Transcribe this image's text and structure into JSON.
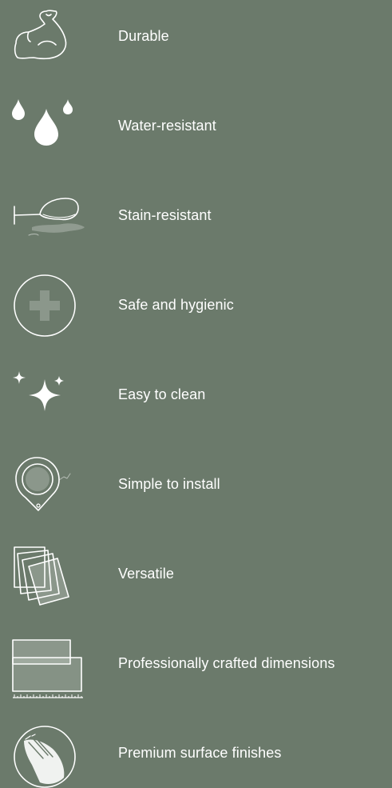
{
  "colors": {
    "background": "#6b7a6b",
    "foreground": "#ffffff"
  },
  "features": [
    {
      "label": "Durable",
      "icon": "flexed-bicep-icon"
    },
    {
      "label": "Water-resistant",
      "icon": "water-drops-icon"
    },
    {
      "label": "Stain-resistant",
      "icon": "spilled-wine-glass-icon"
    },
    {
      "label": "Safe and hygienic",
      "icon": "medical-cross-icon"
    },
    {
      "label": "Easy to clean",
      "icon": "sparkles-icon"
    },
    {
      "label": "Simple to install",
      "icon": "tape-measure-icon"
    },
    {
      "label": "Versatile",
      "icon": "tile-samples-icon"
    },
    {
      "label": "Professionally crafted dimensions",
      "icon": "tiles-with-ruler-icon"
    },
    {
      "label": "Premium surface finishes",
      "icon": "hand-touching-surface-icon"
    }
  ]
}
